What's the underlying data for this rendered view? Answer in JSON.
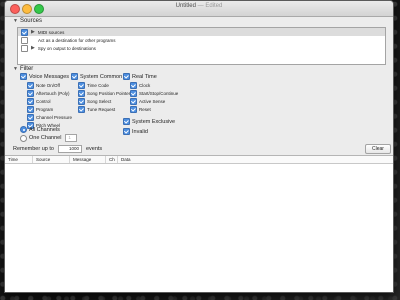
{
  "window": {
    "title": "Untitled",
    "edited": "— Edited"
  },
  "sources": {
    "label": "Sources",
    "items": [
      {
        "label": "MIDI sources",
        "checked": true,
        "expandable": true,
        "selected": true
      },
      {
        "label": "Act as a destination for other programs",
        "checked": false,
        "expandable": false,
        "selected": false
      },
      {
        "label": "Spy on output to destinations",
        "checked": false,
        "expandable": true,
        "selected": false
      }
    ]
  },
  "filter": {
    "label": "Filter",
    "voice_messages": {
      "label": "Voice Messages",
      "items": [
        "Note On/Off",
        "Aftertouch (Poly)",
        "Control",
        "Program",
        "Channel Pressure",
        "Pitch Wheel"
      ]
    },
    "system_common": {
      "label": "System Common",
      "items": [
        "Time Code",
        "Song Position Pointer",
        "Song Select",
        "Tune Request"
      ]
    },
    "real_time": {
      "label": "Real Time",
      "items": [
        "Clock",
        "Start/Stop/Continue",
        "Active Sense",
        "Reset"
      ]
    },
    "system_exclusive": "System Exclusive",
    "invalid": "Invalid",
    "all_channels": "All Channels",
    "one_channel": "One Channel",
    "one_channel_value": "1"
  },
  "remember": {
    "prefix": "Remember up to",
    "value": "1000",
    "suffix": "events"
  },
  "clear_label": "Clear",
  "table": {
    "columns": [
      "Time",
      "Source",
      "Message",
      "Ch",
      "Data"
    ]
  }
}
